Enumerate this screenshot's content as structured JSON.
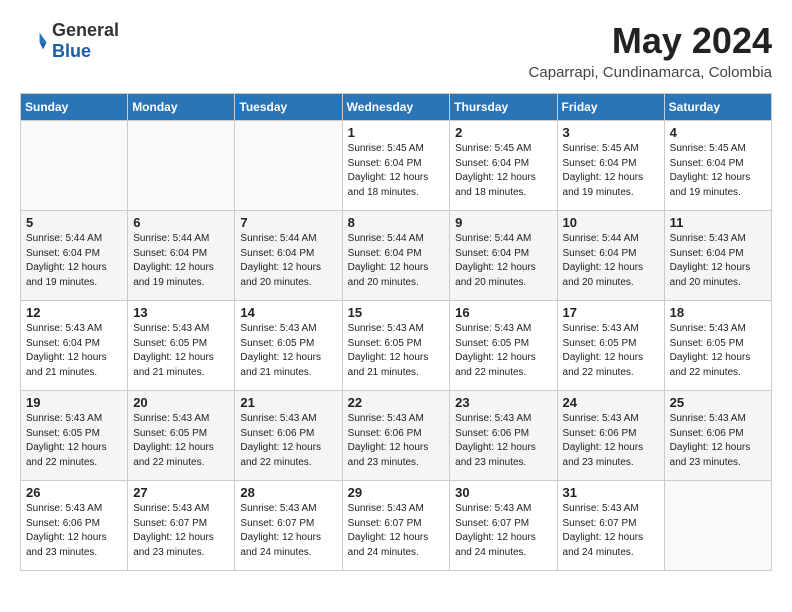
{
  "header": {
    "logo_general": "General",
    "logo_blue": "Blue",
    "month_title": "May 2024",
    "subtitle": "Caparrapi, Cundinamarca, Colombia"
  },
  "weekdays": [
    "Sunday",
    "Monday",
    "Tuesday",
    "Wednesday",
    "Thursday",
    "Friday",
    "Saturday"
  ],
  "weeks": [
    [
      {
        "day": "",
        "info": ""
      },
      {
        "day": "",
        "info": ""
      },
      {
        "day": "",
        "info": ""
      },
      {
        "day": "1",
        "info": "Sunrise: 5:45 AM\nSunset: 6:04 PM\nDaylight: 12 hours\nand 18 minutes."
      },
      {
        "day": "2",
        "info": "Sunrise: 5:45 AM\nSunset: 6:04 PM\nDaylight: 12 hours\nand 18 minutes."
      },
      {
        "day": "3",
        "info": "Sunrise: 5:45 AM\nSunset: 6:04 PM\nDaylight: 12 hours\nand 19 minutes."
      },
      {
        "day": "4",
        "info": "Sunrise: 5:45 AM\nSunset: 6:04 PM\nDaylight: 12 hours\nand 19 minutes."
      }
    ],
    [
      {
        "day": "5",
        "info": "Sunrise: 5:44 AM\nSunset: 6:04 PM\nDaylight: 12 hours\nand 19 minutes."
      },
      {
        "day": "6",
        "info": "Sunrise: 5:44 AM\nSunset: 6:04 PM\nDaylight: 12 hours\nand 19 minutes."
      },
      {
        "day": "7",
        "info": "Sunrise: 5:44 AM\nSunset: 6:04 PM\nDaylight: 12 hours\nand 20 minutes."
      },
      {
        "day": "8",
        "info": "Sunrise: 5:44 AM\nSunset: 6:04 PM\nDaylight: 12 hours\nand 20 minutes."
      },
      {
        "day": "9",
        "info": "Sunrise: 5:44 AM\nSunset: 6:04 PM\nDaylight: 12 hours\nand 20 minutes."
      },
      {
        "day": "10",
        "info": "Sunrise: 5:44 AM\nSunset: 6:04 PM\nDaylight: 12 hours\nand 20 minutes."
      },
      {
        "day": "11",
        "info": "Sunrise: 5:43 AM\nSunset: 6:04 PM\nDaylight: 12 hours\nand 20 minutes."
      }
    ],
    [
      {
        "day": "12",
        "info": "Sunrise: 5:43 AM\nSunset: 6:04 PM\nDaylight: 12 hours\nand 21 minutes."
      },
      {
        "day": "13",
        "info": "Sunrise: 5:43 AM\nSunset: 6:05 PM\nDaylight: 12 hours\nand 21 minutes."
      },
      {
        "day": "14",
        "info": "Sunrise: 5:43 AM\nSunset: 6:05 PM\nDaylight: 12 hours\nand 21 minutes."
      },
      {
        "day": "15",
        "info": "Sunrise: 5:43 AM\nSunset: 6:05 PM\nDaylight: 12 hours\nand 21 minutes."
      },
      {
        "day": "16",
        "info": "Sunrise: 5:43 AM\nSunset: 6:05 PM\nDaylight: 12 hours\nand 22 minutes."
      },
      {
        "day": "17",
        "info": "Sunrise: 5:43 AM\nSunset: 6:05 PM\nDaylight: 12 hours\nand 22 minutes."
      },
      {
        "day": "18",
        "info": "Sunrise: 5:43 AM\nSunset: 6:05 PM\nDaylight: 12 hours\nand 22 minutes."
      }
    ],
    [
      {
        "day": "19",
        "info": "Sunrise: 5:43 AM\nSunset: 6:05 PM\nDaylight: 12 hours\nand 22 minutes."
      },
      {
        "day": "20",
        "info": "Sunrise: 5:43 AM\nSunset: 6:05 PM\nDaylight: 12 hours\nand 22 minutes."
      },
      {
        "day": "21",
        "info": "Sunrise: 5:43 AM\nSunset: 6:06 PM\nDaylight: 12 hours\nand 22 minutes."
      },
      {
        "day": "22",
        "info": "Sunrise: 5:43 AM\nSunset: 6:06 PM\nDaylight: 12 hours\nand 23 minutes."
      },
      {
        "day": "23",
        "info": "Sunrise: 5:43 AM\nSunset: 6:06 PM\nDaylight: 12 hours\nand 23 minutes."
      },
      {
        "day": "24",
        "info": "Sunrise: 5:43 AM\nSunset: 6:06 PM\nDaylight: 12 hours\nand 23 minutes."
      },
      {
        "day": "25",
        "info": "Sunrise: 5:43 AM\nSunset: 6:06 PM\nDaylight: 12 hours\nand 23 minutes."
      }
    ],
    [
      {
        "day": "26",
        "info": "Sunrise: 5:43 AM\nSunset: 6:06 PM\nDaylight: 12 hours\nand 23 minutes."
      },
      {
        "day": "27",
        "info": "Sunrise: 5:43 AM\nSunset: 6:07 PM\nDaylight: 12 hours\nand 23 minutes."
      },
      {
        "day": "28",
        "info": "Sunrise: 5:43 AM\nSunset: 6:07 PM\nDaylight: 12 hours\nand 24 minutes."
      },
      {
        "day": "29",
        "info": "Sunrise: 5:43 AM\nSunset: 6:07 PM\nDaylight: 12 hours\nand 24 minutes."
      },
      {
        "day": "30",
        "info": "Sunrise: 5:43 AM\nSunset: 6:07 PM\nDaylight: 12 hours\nand 24 minutes."
      },
      {
        "day": "31",
        "info": "Sunrise: 5:43 AM\nSunset: 6:07 PM\nDaylight: 12 hours\nand 24 minutes."
      },
      {
        "day": "",
        "info": ""
      }
    ]
  ]
}
